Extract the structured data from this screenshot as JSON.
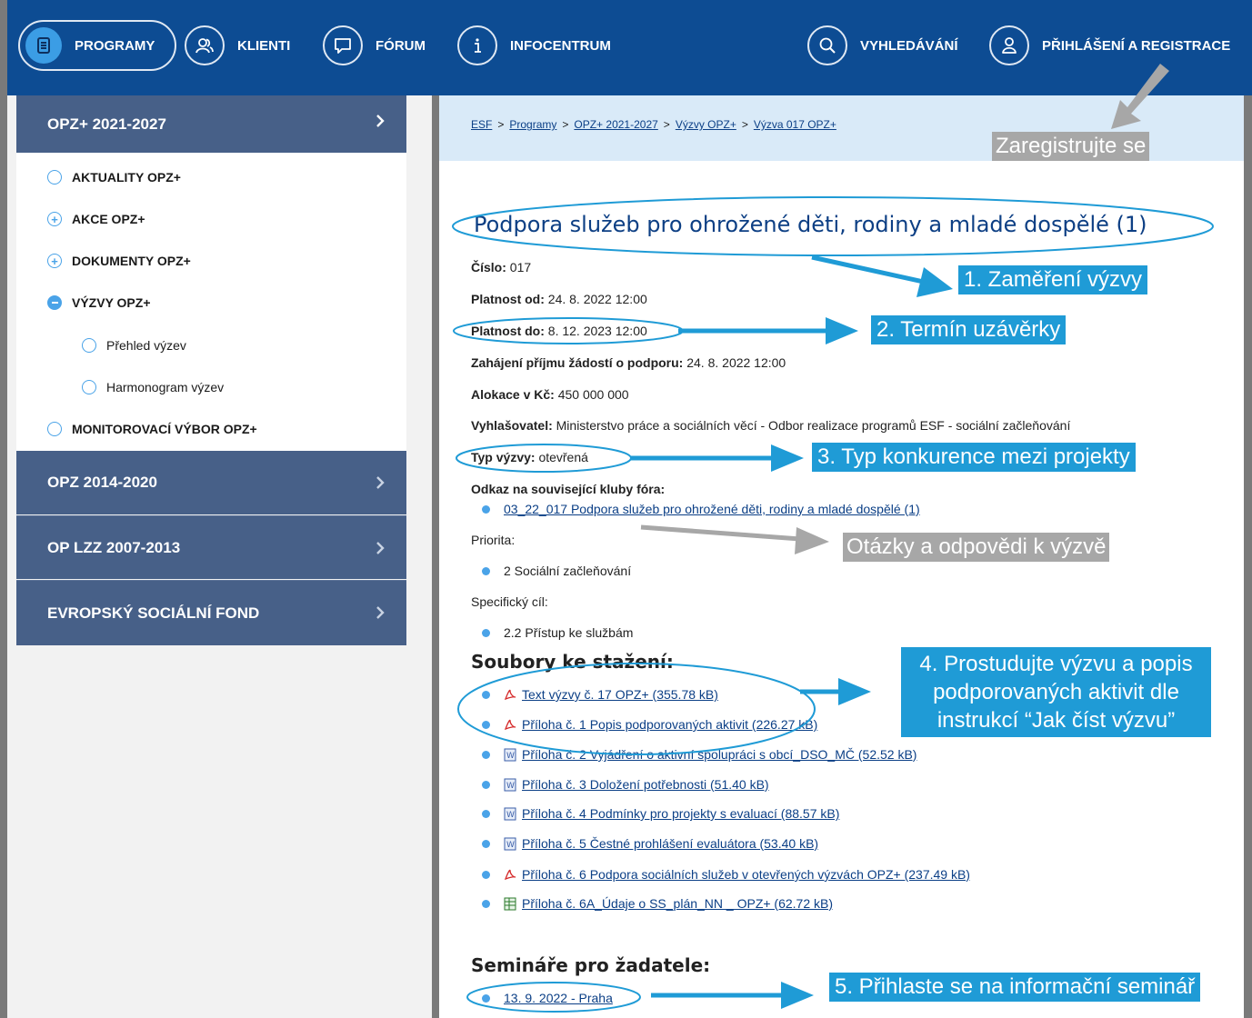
{
  "nav": {
    "programy": "PROGRAMY",
    "klienti": "KLIENTI",
    "forum": "FÓRUM",
    "infocentrum": "INFOCENTRUM",
    "vyhledavani": "VYHLEDÁVÁNÍ",
    "prihlaseni": "PŘIHLÁŠENÍ A REGISTRACE"
  },
  "sidebar": {
    "active_section": "OPZ+ 2021-2027",
    "items": [
      {
        "label": "AKTUALITY OPZ+",
        "icon": "circle-icon"
      },
      {
        "label": "AKCE OPZ+",
        "icon": "plus-circle-icon"
      },
      {
        "label": "DOKUMENTY OPZ+",
        "icon": "plus-circle-icon"
      },
      {
        "label": "VÝZVY OPZ+",
        "icon": "minus-circle-icon"
      },
      {
        "label": "Přehled výzev",
        "icon": "circle-icon"
      },
      {
        "label": "Harmonogram výzev",
        "icon": "circle-icon"
      },
      {
        "label": "MONITOROVACÍ VÝBOR OPZ+",
        "icon": "circle-icon"
      }
    ],
    "sections": [
      "OPZ 2014-2020",
      "OP LZZ 2007-2013",
      "EVROPSKÝ SOCIÁLNÍ FOND"
    ]
  },
  "breadcrumb": [
    "ESF",
    "Programy",
    "OPZ+ 2021-2027",
    "Výzvy OPZ+",
    "Výzva 017 OPZ+"
  ],
  "breadcrumb_sep": ">",
  "title": "Podpora služeb pro ohrožené děti, rodiny a mladé dospělé (1)",
  "details": {
    "cislo_label": "Číslo:",
    "cislo": "017",
    "od_label": "Platnost od:",
    "od": "24. 8. 2022 12:00",
    "do_label": "Platnost do:",
    "do": "8. 12. 2023 12:00",
    "zahajeni_label": "Zahájení příjmu žádostí o podporu:",
    "zahajeni": "24. 8. 2022 12:00",
    "alokace_label": "Alokace v Kč:",
    "alokace": "450 000 000",
    "vyhlasovatel_label": "Vyhlašovatel:",
    "vyhlasovatel": "Ministerstvo práce a sociálních věcí - Odbor realizace programů ESF - sociální začleňování",
    "typ_label": "Typ výzvy:",
    "typ": "otevřená",
    "odkaz_label": "Odkaz na související kluby fóra:",
    "odkaz": "03_22_017 Podpora služeb pro ohrožené děti, rodiny a mladé dospělé (1)",
    "priorita_label": "Priorita:",
    "priorita": "2 Sociální začleňování",
    "cil_label": "Specifický cíl:",
    "cil": "2.2 Přístup ke službám"
  },
  "downloads_heading": "Soubory ke stažení:",
  "files": [
    {
      "label": "Text výzvy č. 17 OPZ+ (355.78 kB)",
      "icon": "pdf-icon"
    },
    {
      "label": "Příloha č. 1 Popis podporovaných aktivit (226.27 kB)",
      "icon": "pdf-icon"
    },
    {
      "label": "Příloha č. 2 Vyjádření o aktivní spolupráci s obcí_DSO_MČ (52.52 kB)",
      "icon": "word-icon"
    },
    {
      "label": "Příloha č. 3 Doložení potřebnosti (51.40 kB)",
      "icon": "word-icon"
    },
    {
      "label": "Příloha č. 4  Podmínky pro projekty s evaluací (88.57 kB)",
      "icon": "word-icon"
    },
    {
      "label": "Příloha č. 5 Čestné prohlášení evaluátora (53.40 kB)",
      "icon": "word-icon"
    },
    {
      "label": "Příloha č. 6 Podpora sociálních služeb v otevřených výzvách OPZ+ (237.49 kB)",
      "icon": "pdf-icon"
    },
    {
      "label": "Příloha č. 6A_Údaje o SS_plán_NN _ OPZ+ (62.72 kB)",
      "icon": "excel-icon"
    }
  ],
  "seminars_heading": "Semináře pro žadatele:",
  "seminar": "13. 9. 2022 - Praha",
  "annotations": {
    "zaregistrujte": "Zaregistrujte se",
    "c1": "1. Zaměření výzvy",
    "c2": "2. Termín uzávěrky",
    "c3": "3. Typ konkurence mezi projekty",
    "otazky": "Otázky a odpovědi k výzvě",
    "c4_line1": "4. Prostudujte výzvu a popis",
    "c4_line2": "podporovaných aktivit dle",
    "c4_line3": "instrukcí “Jak číst výzvu”",
    "c5": "5. Přihlaste se na informační seminář"
  },
  "colors": {
    "nav_bg": "#0d4c93",
    "sidebar_section": "#476088",
    "accent": "#1f9bd6",
    "link": "#0b3f86"
  }
}
